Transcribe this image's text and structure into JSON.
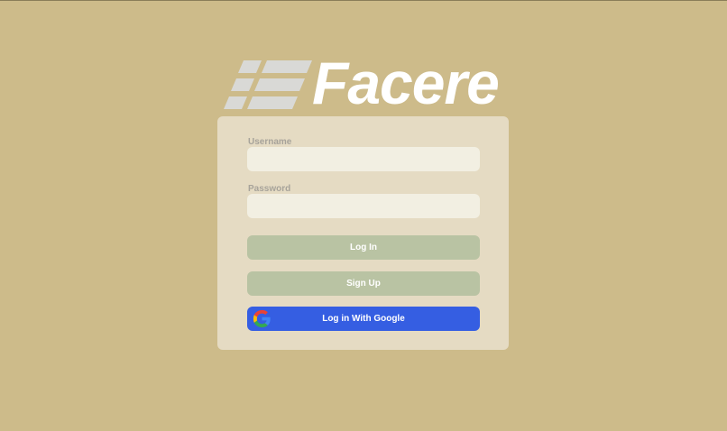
{
  "brand": {
    "name": "Facere"
  },
  "login_form": {
    "username_label": "Username",
    "username_value": "",
    "password_label": "Password",
    "password_value": "",
    "login_button": "Log In",
    "signup_button": "Sign Up",
    "google_button": "Log in With Google"
  },
  "colors": {
    "background": "#cdbb8a",
    "card": "#e5dbc3",
    "input": "#f2efe2",
    "primary_button": "#b9c3a3",
    "google_button": "#355ee2",
    "brand_text": "#ffffff"
  },
  "icons": {
    "brand_mark": "stacked-stripes-logo",
    "google": "google-g-icon"
  }
}
